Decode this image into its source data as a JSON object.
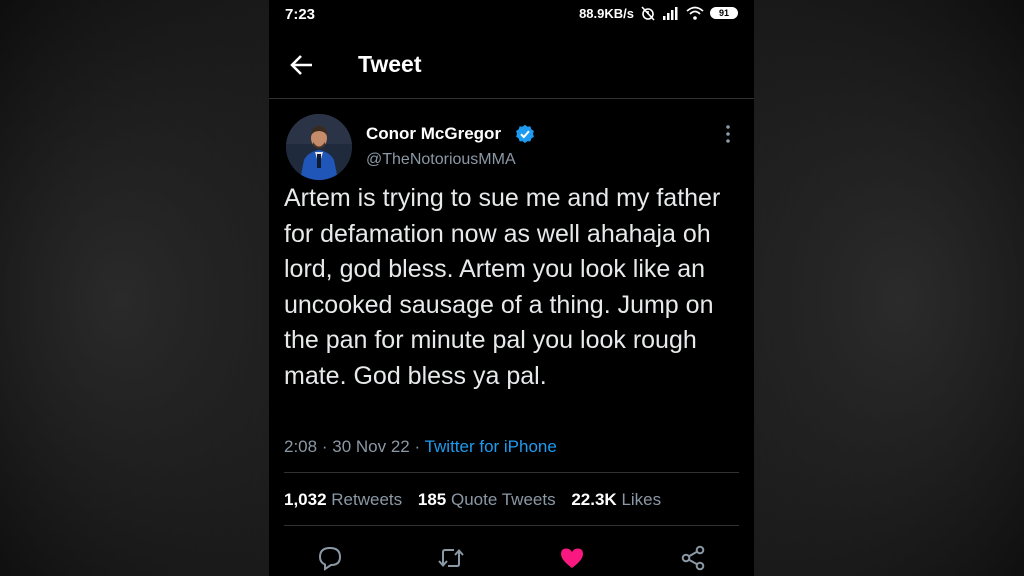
{
  "status_bar": {
    "time": "7:23",
    "network_speed": "88.9KB/s",
    "battery_level": "91",
    "icons": [
      "alarm-off-icon",
      "signal-icon",
      "wifi-icon",
      "battery-icon"
    ]
  },
  "header": {
    "title": "Tweet",
    "back_icon": "arrow-left-icon"
  },
  "tweet": {
    "author_name": "Conor McGregor",
    "author_handle": "@TheNotoriousMMA",
    "verified": true,
    "text": "Artem is trying to sue me and my father for defamation now as well ahahaja oh lord, god bless. Artem you look like an uncooked sausage of a thing. Jump on the pan for minute pal you look rough mate. God bless ya pal.",
    "time": "2:08",
    "separator": "·",
    "date": "30 Nov 22",
    "source": "Twitter for iPhone"
  },
  "stats": {
    "retweets_count": "1,032",
    "retweets_label": "Retweets",
    "quotes_count": "185",
    "quotes_label": "Quote Tweets",
    "likes_count": "22.3K",
    "likes_label": "Likes"
  },
  "actions": [
    "reply-icon",
    "retweet-icon",
    "like-icon",
    "share-icon"
  ],
  "colors": {
    "accent": "#1d9bf0",
    "like": "#f91880",
    "background": "#000000",
    "text_secondary": "#8b98a5"
  }
}
